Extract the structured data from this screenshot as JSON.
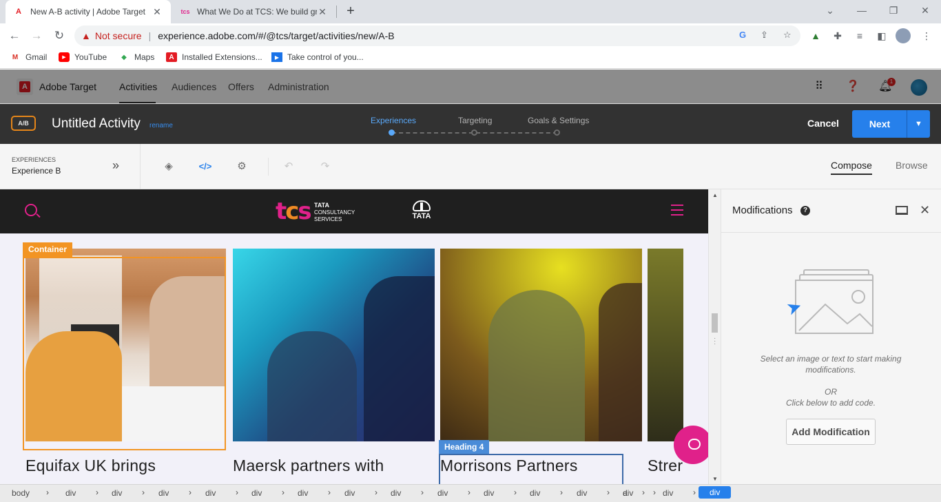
{
  "browser": {
    "tabs": [
      {
        "title": "New A-B activity | Adobe Target",
        "favicon": "adobe-icon",
        "active": true
      },
      {
        "title": "What We Do at TCS: We build gre",
        "favicon": "tcs-icon",
        "active": false
      }
    ],
    "url_warning": "Not secure",
    "url": "experience.adobe.com/#/@tcs/target/activities/new/A-B",
    "bookmarks": [
      {
        "label": "Gmail",
        "icon": "gmail-icon"
      },
      {
        "label": "YouTube",
        "icon": "youtube-icon"
      },
      {
        "label": "Maps",
        "icon": "maps-icon"
      },
      {
        "label": "Installed Extensions...",
        "icon": "adobe-icon"
      },
      {
        "label": "Take control of you...",
        "icon": "bookmark-icon"
      }
    ]
  },
  "app": {
    "name": "Adobe Target",
    "nav": [
      "Activities",
      "Audiences",
      "Offers",
      "Administration"
    ],
    "notifications_count": "1"
  },
  "activity": {
    "type_badge": "A/B",
    "title": "Untitled Activity",
    "rename_label": "rename",
    "steps": [
      "Experiences",
      "Targeting",
      "Goals & Settings"
    ],
    "cancel_label": "Cancel",
    "next_label": "Next"
  },
  "experience": {
    "section_label": "EXPERIENCES",
    "current": "Experience B",
    "mode_compose": "Compose",
    "mode_browse": "Browse"
  },
  "preview": {
    "logo_line1": "TATA",
    "logo_line2": "CONSULTANCY",
    "logo_line3": "SERVICES",
    "tata_text": "TATA",
    "container_tag": "Container",
    "heading_tag": "Heading 4",
    "cards": [
      {
        "title": "Equifax UK brings"
      },
      {
        "title": "Maersk partners with"
      },
      {
        "title": "Morrisons Partners"
      },
      {
        "title": "Strer"
      }
    ]
  },
  "panel": {
    "title": "Modifications",
    "hint1": "Select an image or text to start making modifications.",
    "or": "OR",
    "hint2": "Click below to add code.",
    "add_button": "Add Modification"
  },
  "breadcrumb": [
    "body",
    "div",
    "div",
    "div",
    "div",
    "div",
    "div",
    "div",
    "div",
    "div",
    "div",
    "div",
    "div",
    "div",
    "a",
    "div",
    "div"
  ]
}
